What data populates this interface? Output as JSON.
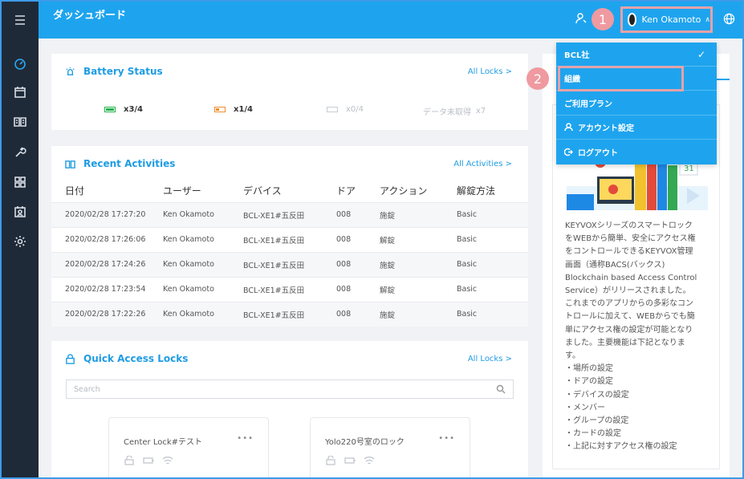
{
  "header": {
    "title": "ダッシュボード",
    "user_name": "Ken Okamoto"
  },
  "annotations": {
    "step1": "1",
    "step2": "2"
  },
  "dropdown": {
    "items": [
      {
        "label": "BCL社",
        "checked": true
      },
      {
        "label": "組織"
      },
      {
        "label": "ご利用プラン"
      },
      {
        "label": "アカウント設定"
      },
      {
        "label": "ログアウト"
      }
    ]
  },
  "battery": {
    "title": "Battery Status",
    "link": "All Locks >",
    "items": [
      {
        "label": "x3/4",
        "color": "#22b14c"
      },
      {
        "label": "x1/4",
        "color": "#f08c2c"
      },
      {
        "label": "x0/4"
      },
      {
        "label": "データ未取得",
        "count": "x7"
      }
    ]
  },
  "activities": {
    "title": "Recent Activities",
    "link": "All Activities >",
    "columns": [
      "日付",
      "ユーザー",
      "デバイス",
      "ドア",
      "アクション",
      "解錠方法"
    ],
    "rows": [
      [
        "2020/02/28 17:27:20",
        "Ken Okamoto",
        "BCL-XE1#五反田",
        "008",
        "施錠",
        "Basic"
      ],
      [
        "2020/02/28 17:26:06",
        "Ken Okamoto",
        "BCL-XE1#五反田",
        "008",
        "解錠",
        "Basic"
      ],
      [
        "2020/02/28 17:24:26",
        "Ken Okamoto",
        "BCL-XE1#五反田",
        "008",
        "施錠",
        "Basic"
      ],
      [
        "2020/02/28 17:23:54",
        "Ken Okamoto",
        "BCL-XE1#五反田",
        "008",
        "解錠",
        "Basic"
      ],
      [
        "2020/02/28 17:22:26",
        "Ken Okamoto",
        "BCL-XE1#五反田",
        "008",
        "施錠",
        "Basic"
      ]
    ]
  },
  "quick_access": {
    "title": "Quick Access Locks",
    "link": "All Locks >",
    "search_placeholder": "Search",
    "locks": [
      {
        "name": "Center Lock#テスト",
        "menu": "•••"
      },
      {
        "name": "Yolo220号室のロック",
        "menu": "•••"
      }
    ]
  },
  "news": {
    "text": "KEYVOXシリーズのスマートロック\nをWEBから簡単、安全にアクセス権\nをコントロールできるKEYVOX管理\n画面（通称BACS(バックス)\nBlockchain based Access Control\nService）がリリースされました。\nこれまでのアプリからの多彩なコン\nトロールに加えて、WEBからでも簡\n単にアクセス権の設定が可能となり\nました。主要機能は下記となりま\nす。\n・場所の設定\n・ドアの設定\n・デバイスの設定\n・メンバー\n・グループの設定\n・カードの設定\n・上記に対すアクセス権の設定",
    "calendar_number": "31"
  },
  "colors": {
    "accent": "#1ea4ee",
    "sidebar": "#1f2a38",
    "annotation": "#ef9aa0"
  },
  "sidebar": {
    "icons": [
      "menu-icon",
      "dashboard-icon",
      "calendar-icon",
      "book-icon",
      "wrench-icon",
      "grid-icon",
      "contact-icon",
      "gear-icon"
    ]
  }
}
